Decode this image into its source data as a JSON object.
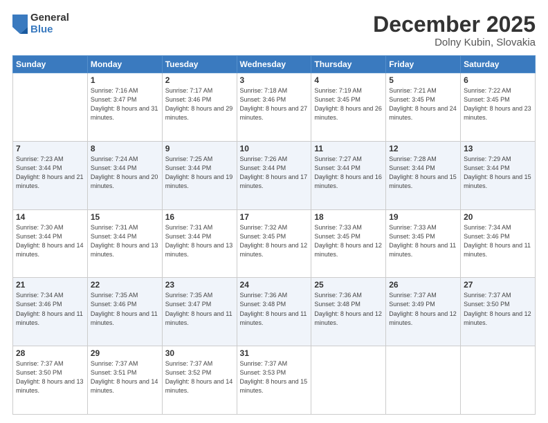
{
  "logo": {
    "general": "General",
    "blue": "Blue"
  },
  "header": {
    "month": "December 2025",
    "location": "Dolny Kubin, Slovakia"
  },
  "weekdays": [
    "Sunday",
    "Monday",
    "Tuesday",
    "Wednesday",
    "Thursday",
    "Friday",
    "Saturday"
  ],
  "weeks": [
    [
      {
        "day": "",
        "sunrise": "",
        "sunset": "",
        "daylight": ""
      },
      {
        "day": "1",
        "sunrise": "Sunrise: 7:16 AM",
        "sunset": "Sunset: 3:47 PM",
        "daylight": "Daylight: 8 hours and 31 minutes."
      },
      {
        "day": "2",
        "sunrise": "Sunrise: 7:17 AM",
        "sunset": "Sunset: 3:46 PM",
        "daylight": "Daylight: 8 hours and 29 minutes."
      },
      {
        "day": "3",
        "sunrise": "Sunrise: 7:18 AM",
        "sunset": "Sunset: 3:46 PM",
        "daylight": "Daylight: 8 hours and 27 minutes."
      },
      {
        "day": "4",
        "sunrise": "Sunrise: 7:19 AM",
        "sunset": "Sunset: 3:45 PM",
        "daylight": "Daylight: 8 hours and 26 minutes."
      },
      {
        "day": "5",
        "sunrise": "Sunrise: 7:21 AM",
        "sunset": "Sunset: 3:45 PM",
        "daylight": "Daylight: 8 hours and 24 minutes."
      },
      {
        "day": "6",
        "sunrise": "Sunrise: 7:22 AM",
        "sunset": "Sunset: 3:45 PM",
        "daylight": "Daylight: 8 hours and 23 minutes."
      }
    ],
    [
      {
        "day": "7",
        "sunrise": "Sunrise: 7:23 AM",
        "sunset": "Sunset: 3:44 PM",
        "daylight": "Daylight: 8 hours and 21 minutes."
      },
      {
        "day": "8",
        "sunrise": "Sunrise: 7:24 AM",
        "sunset": "Sunset: 3:44 PM",
        "daylight": "Daylight: 8 hours and 20 minutes."
      },
      {
        "day": "9",
        "sunrise": "Sunrise: 7:25 AM",
        "sunset": "Sunset: 3:44 PM",
        "daylight": "Daylight: 8 hours and 19 minutes."
      },
      {
        "day": "10",
        "sunrise": "Sunrise: 7:26 AM",
        "sunset": "Sunset: 3:44 PM",
        "daylight": "Daylight: 8 hours and 17 minutes."
      },
      {
        "day": "11",
        "sunrise": "Sunrise: 7:27 AM",
        "sunset": "Sunset: 3:44 PM",
        "daylight": "Daylight: 8 hours and 16 minutes."
      },
      {
        "day": "12",
        "sunrise": "Sunrise: 7:28 AM",
        "sunset": "Sunset: 3:44 PM",
        "daylight": "Daylight: 8 hours and 15 minutes."
      },
      {
        "day": "13",
        "sunrise": "Sunrise: 7:29 AM",
        "sunset": "Sunset: 3:44 PM",
        "daylight": "Daylight: 8 hours and 15 minutes."
      }
    ],
    [
      {
        "day": "14",
        "sunrise": "Sunrise: 7:30 AM",
        "sunset": "Sunset: 3:44 PM",
        "daylight": "Daylight: 8 hours and 14 minutes."
      },
      {
        "day": "15",
        "sunrise": "Sunrise: 7:31 AM",
        "sunset": "Sunset: 3:44 PM",
        "daylight": "Daylight: 8 hours and 13 minutes."
      },
      {
        "day": "16",
        "sunrise": "Sunrise: 7:31 AM",
        "sunset": "Sunset: 3:44 PM",
        "daylight": "Daylight: 8 hours and 13 minutes."
      },
      {
        "day": "17",
        "sunrise": "Sunrise: 7:32 AM",
        "sunset": "Sunset: 3:45 PM",
        "daylight": "Daylight: 8 hours and 12 minutes."
      },
      {
        "day": "18",
        "sunrise": "Sunrise: 7:33 AM",
        "sunset": "Sunset: 3:45 PM",
        "daylight": "Daylight: 8 hours and 12 minutes."
      },
      {
        "day": "19",
        "sunrise": "Sunrise: 7:33 AM",
        "sunset": "Sunset: 3:45 PM",
        "daylight": "Daylight: 8 hours and 11 minutes."
      },
      {
        "day": "20",
        "sunrise": "Sunrise: 7:34 AM",
        "sunset": "Sunset: 3:46 PM",
        "daylight": "Daylight: 8 hours and 11 minutes."
      }
    ],
    [
      {
        "day": "21",
        "sunrise": "Sunrise: 7:34 AM",
        "sunset": "Sunset: 3:46 PM",
        "daylight": "Daylight: 8 hours and 11 minutes."
      },
      {
        "day": "22",
        "sunrise": "Sunrise: 7:35 AM",
        "sunset": "Sunset: 3:46 PM",
        "daylight": "Daylight: 8 hours and 11 minutes."
      },
      {
        "day": "23",
        "sunrise": "Sunrise: 7:35 AM",
        "sunset": "Sunset: 3:47 PM",
        "daylight": "Daylight: 8 hours and 11 minutes."
      },
      {
        "day": "24",
        "sunrise": "Sunrise: 7:36 AM",
        "sunset": "Sunset: 3:48 PM",
        "daylight": "Daylight: 8 hours and 11 minutes."
      },
      {
        "day": "25",
        "sunrise": "Sunrise: 7:36 AM",
        "sunset": "Sunset: 3:48 PM",
        "daylight": "Daylight: 8 hours and 12 minutes."
      },
      {
        "day": "26",
        "sunrise": "Sunrise: 7:37 AM",
        "sunset": "Sunset: 3:49 PM",
        "daylight": "Daylight: 8 hours and 12 minutes."
      },
      {
        "day": "27",
        "sunrise": "Sunrise: 7:37 AM",
        "sunset": "Sunset: 3:50 PM",
        "daylight": "Daylight: 8 hours and 12 minutes."
      }
    ],
    [
      {
        "day": "28",
        "sunrise": "Sunrise: 7:37 AM",
        "sunset": "Sunset: 3:50 PM",
        "daylight": "Daylight: 8 hours and 13 minutes."
      },
      {
        "day": "29",
        "sunrise": "Sunrise: 7:37 AM",
        "sunset": "Sunset: 3:51 PM",
        "daylight": "Daylight: 8 hours and 14 minutes."
      },
      {
        "day": "30",
        "sunrise": "Sunrise: 7:37 AM",
        "sunset": "Sunset: 3:52 PM",
        "daylight": "Daylight: 8 hours and 14 minutes."
      },
      {
        "day": "31",
        "sunrise": "Sunrise: 7:37 AM",
        "sunset": "Sunset: 3:53 PM",
        "daylight": "Daylight: 8 hours and 15 minutes."
      },
      {
        "day": "",
        "sunrise": "",
        "sunset": "",
        "daylight": ""
      },
      {
        "day": "",
        "sunrise": "",
        "sunset": "",
        "daylight": ""
      },
      {
        "day": "",
        "sunrise": "",
        "sunset": "",
        "daylight": ""
      }
    ]
  ]
}
